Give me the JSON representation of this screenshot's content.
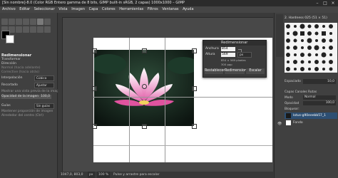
{
  "window": {
    "title": "[Sin nombre]-8.0 (Color RGB Entero gamma de 8 bits, GIMP built-in sRGB, 2 capas) 1000x1000 – GIMP",
    "controls": [
      "–",
      "□",
      "×"
    ]
  },
  "menubar": {
    "items": [
      "Archivo",
      "Editar",
      "Seleccionar",
      "Vista",
      "Imagen",
      "Capa",
      "Colores",
      "Herramientas",
      "Filtros",
      "Ventanas",
      "Ayuda"
    ]
  },
  "tool_options": {
    "title": "Redimensionar",
    "subtitle": "Transformar",
    "direction_label": "Dirección",
    "normal_option": "Normal (hacia adelante)",
    "corrective_option": "Corrective (hacia atrás)",
    "interpolation_label": "Interpolación",
    "interpolation_value": "Cúbica",
    "clipping_label": "Recortado",
    "clipping_value": "Ajustar",
    "preview_label": "Mostrar una vista previa de la imagen",
    "opacity_label": "Opacidad de la imagen",
    "opacity_value": "100,0",
    "guides_label": "Guías",
    "guides_value": "Sin guías",
    "keep_aspect_label": "Mantener proporción de imagen",
    "around_center_label": "Alrededor del centro (Ctrl)"
  },
  "scale_dialog": {
    "title": "Redimensionar",
    "width_label": "Anchura",
    "width_value": "854",
    "height_label": "Altura",
    "height_value": "569",
    "unit": "px",
    "size_info": "854 × 569 píxeles",
    "resolution_info": "300 ppp",
    "reset_button": "Restablecer",
    "scale_button": "Redimensionar",
    "cancel_button": "Escalar"
  },
  "right_panel": {
    "brushes_title": "Pinceles",
    "brush_selected": "2. Hardness 025 (51 × 51)",
    "spacing_label": "Espaciado",
    "spacing_value": "10,0",
    "tabs_label": "Capas  Canales  Rutas",
    "mode_label": "Modo",
    "mode_value": "Normal",
    "opacity_label": "Opacidad",
    "opacity_value": "100,0",
    "lock_label": "Bloquear:",
    "layers": [
      {
        "name": "lotus-g90eeebb57_1"
      },
      {
        "name": "Fondo"
      }
    ]
  },
  "status": {
    "coords": "1047,0, 803,0",
    "unit": "px",
    "zoom": "100 %",
    "hint": "Pulse y arrastre para escalar"
  },
  "colors": {
    "accent": "#5a5a5a",
    "panel": "#404040",
    "canvas": "#ffffff"
  }
}
